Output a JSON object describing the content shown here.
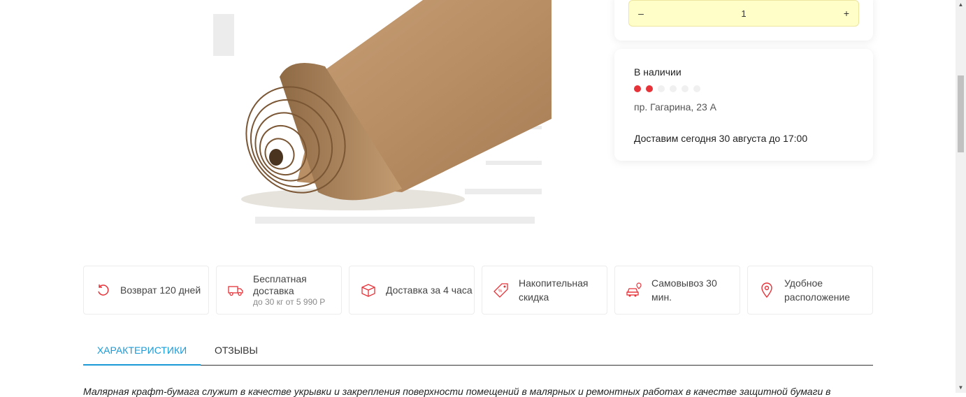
{
  "quantity": {
    "minus_label": "–",
    "value": "1",
    "plus_label": "+"
  },
  "availability": {
    "status": "В наличии",
    "stock_level_filled": 2,
    "stock_level_total": 6,
    "address": "пр. Гагарина, 23 А",
    "delivery": "Доставим сегодня 30 августа до 17:00"
  },
  "benefits": [
    {
      "icon": "return-arrow-icon",
      "label": "Возврат 120 дней",
      "sub": ""
    },
    {
      "icon": "delivery-truck-icon",
      "label": "Бесплатная доставка",
      "sub": "до 30 кг от 5 990 Р"
    },
    {
      "icon": "box-icon",
      "label": "Доставка за 4 часа",
      "sub": ""
    },
    {
      "icon": "discount-tag-icon",
      "label": "Накопительная скидка",
      "sub": ""
    },
    {
      "icon": "car-pickup-icon",
      "label": "Самовывоз 30 мин.",
      "sub": ""
    },
    {
      "icon": "location-pin-icon",
      "label": "Удобное расположение",
      "sub": ""
    }
  ],
  "tabs": [
    {
      "label": "ХАРАКТЕРИСТИКИ",
      "active": true
    },
    {
      "label": "ОТЗЫВЫ",
      "active": false
    }
  ],
  "description": "Малярная крафт-бумага служит в качестве укрывки и закрепления поверхности помещений в малярных и ремонтных работах в качестве защитной бумаги в",
  "colors": {
    "accent_red": "#e63339",
    "tab_active": "#1a9bd7",
    "stepper_bg": "#fffdc8"
  }
}
